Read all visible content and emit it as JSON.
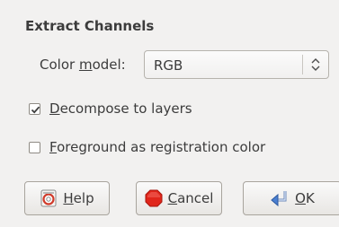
{
  "dialog": {
    "title": "Extract Channels",
    "color_model": {
      "label_prefix": "Color ",
      "label_mnemonic": "m",
      "label_suffix": "odel:",
      "value": "RGB"
    },
    "options": [
      {
        "mnemonic": "D",
        "rest": "ecompose to layers",
        "checked": true
      },
      {
        "mnemonic": "F",
        "rest": "oreground as registration color",
        "checked": false
      }
    ],
    "buttons": {
      "help": {
        "mnemonic": "H",
        "rest": "elp",
        "icon": "help-icon"
      },
      "cancel": {
        "mnemonic": "C",
        "rest": "ancel",
        "icon": "cancel-icon"
      },
      "ok": {
        "mnemonic": "O",
        "rest": "K",
        "icon": "ok-icon"
      }
    }
  },
  "colors": {
    "background": "#f2f1f0",
    "text": "#3c3c3c",
    "cancel_red": "#e0261b",
    "ok_blue": "#4a7fd1"
  }
}
